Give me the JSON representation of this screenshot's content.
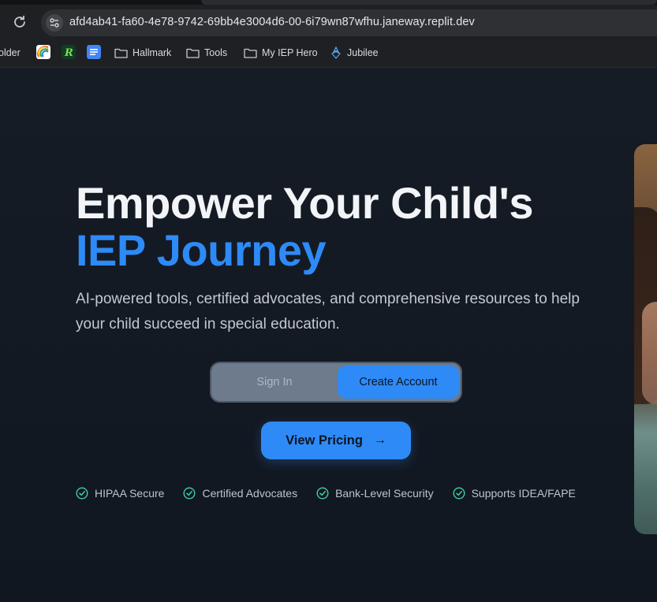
{
  "browser": {
    "url": "afd4ab41-fa60-4e78-9742-69bb4e3004d6-00-6i79wn87wfhu.janeway.replit.dev",
    "bookmarks": [
      {
        "label": "older",
        "icon": "folder-icon"
      },
      {
        "label": "",
        "icon": "rainbow-favicon"
      },
      {
        "label": "",
        "icon": "r-favicon"
      },
      {
        "label": "",
        "icon": "docs-favicon"
      },
      {
        "label": "Hallmark",
        "icon": "folder-icon"
      },
      {
        "label": "Tools",
        "icon": "folder-icon"
      },
      {
        "label": "My IEP Hero",
        "icon": "folder-icon"
      },
      {
        "label": "Jubilee",
        "icon": "jubilee-favicon"
      }
    ]
  },
  "hero": {
    "title_line1": "Empower Your Child's",
    "title_line2": "IEP Journey",
    "subtitle": "AI-powered tools, certified advocates, and comprehensive resources to help your child succeed in special education.",
    "auth_toggle": {
      "sign_in": "Sign In",
      "create_account": "Create Account",
      "selected": "Create Account"
    },
    "pricing_button": "View Pricing",
    "pricing_arrow": "→",
    "badges": [
      "HIPAA Secure",
      "Certified Advocates",
      "Bank-Level Security",
      "Supports IDEA/FAPE"
    ]
  },
  "colors": {
    "accent": "#2e8af6",
    "background": "#151b24",
    "check": "#3fd0a0"
  }
}
